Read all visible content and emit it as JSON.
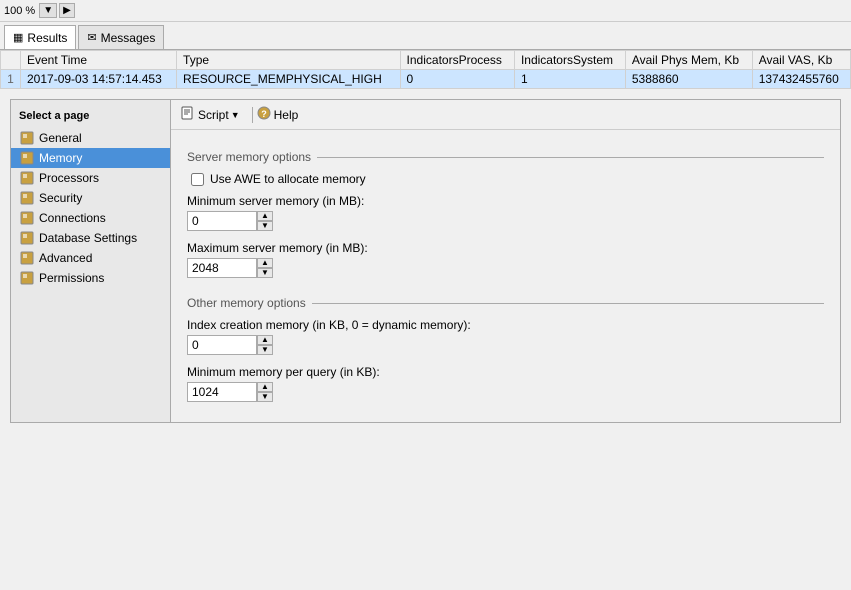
{
  "toolbar": {
    "zoom": "100 %"
  },
  "tabs": [
    {
      "id": "results",
      "label": "Results",
      "icon": "grid-icon",
      "active": true
    },
    {
      "id": "messages",
      "label": "Messages",
      "icon": "message-icon",
      "active": false
    }
  ],
  "table": {
    "columns": [
      "",
      "Event Time",
      "Type",
      "IndicatorsProcess",
      "IndicatorsSystem",
      "Avail Phys Mem, Kb",
      "Avail VAS, Kb"
    ],
    "rows": [
      {
        "rowNum": "1",
        "eventTime": "2017-09-03 14:57:14.453",
        "type": "RESOURCE_MEMPHYSICAL_HIGH",
        "indicatorsProcess": "0",
        "indicatorsSystem": "1",
        "availPhysMem": "5388860",
        "availVAS": "137432455760"
      }
    ]
  },
  "dialog": {
    "sidebar": {
      "header": "Select a page",
      "items": [
        {
          "id": "general",
          "label": "General",
          "active": false
        },
        {
          "id": "memory",
          "label": "Memory",
          "active": true
        },
        {
          "id": "processors",
          "label": "Processors",
          "active": false
        },
        {
          "id": "security",
          "label": "Security",
          "active": false
        },
        {
          "id": "connections",
          "label": "Connections",
          "active": false
        },
        {
          "id": "database-settings",
          "label": "Database Settings",
          "active": false
        },
        {
          "id": "advanced",
          "label": "Advanced",
          "active": false
        },
        {
          "id": "permissions",
          "label": "Permissions",
          "active": false
        }
      ]
    },
    "toolbar": {
      "script_label": "Script",
      "help_label": "Help"
    },
    "sections": {
      "server_memory": {
        "title": "Server memory options",
        "use_awe_label": "Use AWE to allocate memory",
        "min_label": "Minimum server memory (in MB):",
        "min_value": "0",
        "max_label": "Maximum server memory (in MB):",
        "max_value": "2048"
      },
      "other_memory": {
        "title": "Other memory options",
        "index_label": "Index creation memory (in KB, 0 = dynamic memory):",
        "index_value": "0",
        "min_query_label": "Minimum memory per query (in KB):",
        "min_query_value": "1024"
      }
    }
  }
}
